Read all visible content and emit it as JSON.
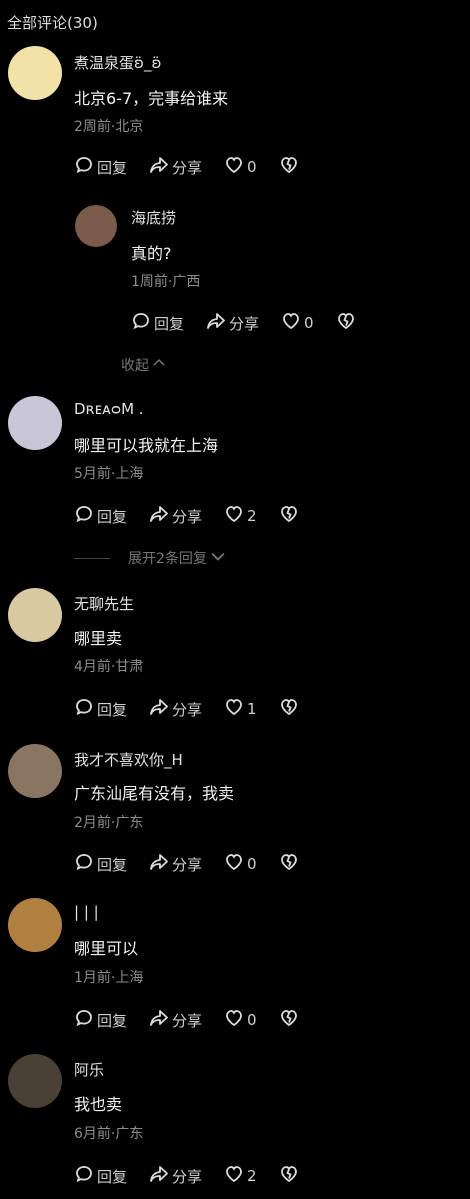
{
  "header": {
    "title": "全部评论(30)"
  },
  "labels": {
    "reply": "回复",
    "share": "分享",
    "collapse": "收起",
    "expand": "展开2条回复"
  },
  "comments": [
    {
      "user": "煮温泉蛋ʚ̈_ʚ̈",
      "text": "北京6-7，完事给谁来",
      "meta": "2周前·北京",
      "likes": "0",
      "avatar_color": "#f3e2a8"
    },
    {
      "user": "DʀᴇᴀᴑM .",
      "text": "哪里可以我就在上海",
      "meta": "5月前·上海",
      "likes": "2",
      "avatar_color": "#c9c6d8"
    },
    {
      "user": "无聊先生",
      "text": "哪里卖",
      "meta": "4月前·甘肃",
      "likes": "1",
      "avatar_color": "#d8c9a0"
    },
    {
      "user": "我才不喜欢你_H",
      "text": "广东汕尾有没有，我卖",
      "meta": "2月前·广东",
      "likes": "0",
      "avatar_color": "#8a7563"
    },
    {
      "user": "| | |",
      "text": "哪里可以",
      "meta": "1月前·上海",
      "likes": "0",
      "avatar_color": "#b08040"
    },
    {
      "user": "阿乐",
      "text": "我也卖",
      "meta": "6月前·广东",
      "likes": "2",
      "avatar_color": "#4a4035"
    }
  ],
  "reply": {
    "user": "海底捞",
    "text": "真的?",
    "meta": "1周前·广西",
    "likes": "0",
    "avatar_color": "#7a5a4a"
  }
}
